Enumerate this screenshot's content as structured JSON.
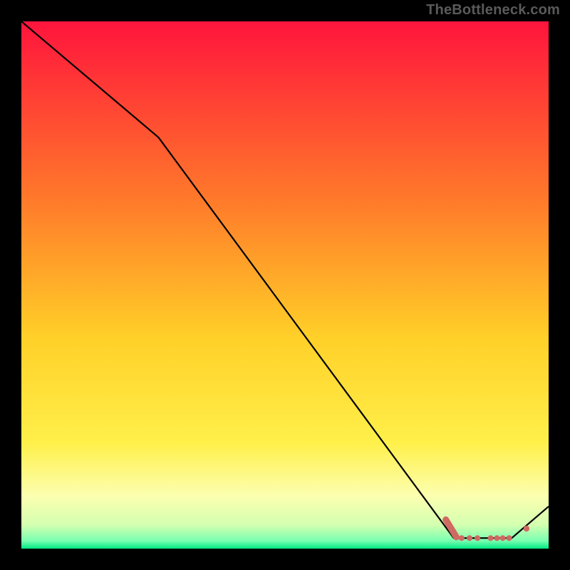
{
  "watermark": "TheBottleneck.com",
  "colors": {
    "bg_black": "#000000",
    "grad_top": "#ff143c",
    "grad_upper_mid": "#ff6a2a",
    "grad_mid": "#ffe22a",
    "grad_lower_mid": "#fff9a0",
    "grad_low": "#edffc0",
    "grad_bottom": "#00e884",
    "line_black": "#000000",
    "marker": "#cf6a62"
  },
  "chart_data": {
    "type": "line",
    "title": "",
    "xlabel": "",
    "ylabel": "",
    "xlim": [
      0,
      100
    ],
    "ylim": [
      0,
      100
    ],
    "main_line": {
      "name": "curve",
      "x": [
        0,
        26,
        82,
        93,
        100
      ],
      "y": [
        100,
        78,
        2,
        2,
        8
      ]
    },
    "flat_segment": {
      "x0": 82,
      "x1": 93,
      "y": 2
    },
    "markers": [
      {
        "x": 82.0,
        "y": 3.0
      },
      {
        "x": 83.5,
        "y": 2.0
      },
      {
        "x": 85.0,
        "y": 2.0
      },
      {
        "x": 86.5,
        "y": 2.0
      },
      {
        "x": 89.0,
        "y": 2.0
      },
      {
        "x": 90.2,
        "y": 2.0
      },
      {
        "x": 91.3,
        "y": 2.0
      },
      {
        "x": 92.5,
        "y": 2.0
      },
      {
        "x": 95.8,
        "y": 3.8
      }
    ],
    "gradient_stops": [
      {
        "offset": 0.0,
        "color": "#ff143c"
      },
      {
        "offset": 0.34,
        "color": "#ff7a2a"
      },
      {
        "offset": 0.6,
        "color": "#ffd028"
      },
      {
        "offset": 0.8,
        "color": "#fff04a"
      },
      {
        "offset": 0.9,
        "color": "#fcffb0"
      },
      {
        "offset": 0.955,
        "color": "#d4ffb0"
      },
      {
        "offset": 0.985,
        "color": "#7affb0"
      },
      {
        "offset": 1.0,
        "color": "#00e884"
      }
    ]
  }
}
